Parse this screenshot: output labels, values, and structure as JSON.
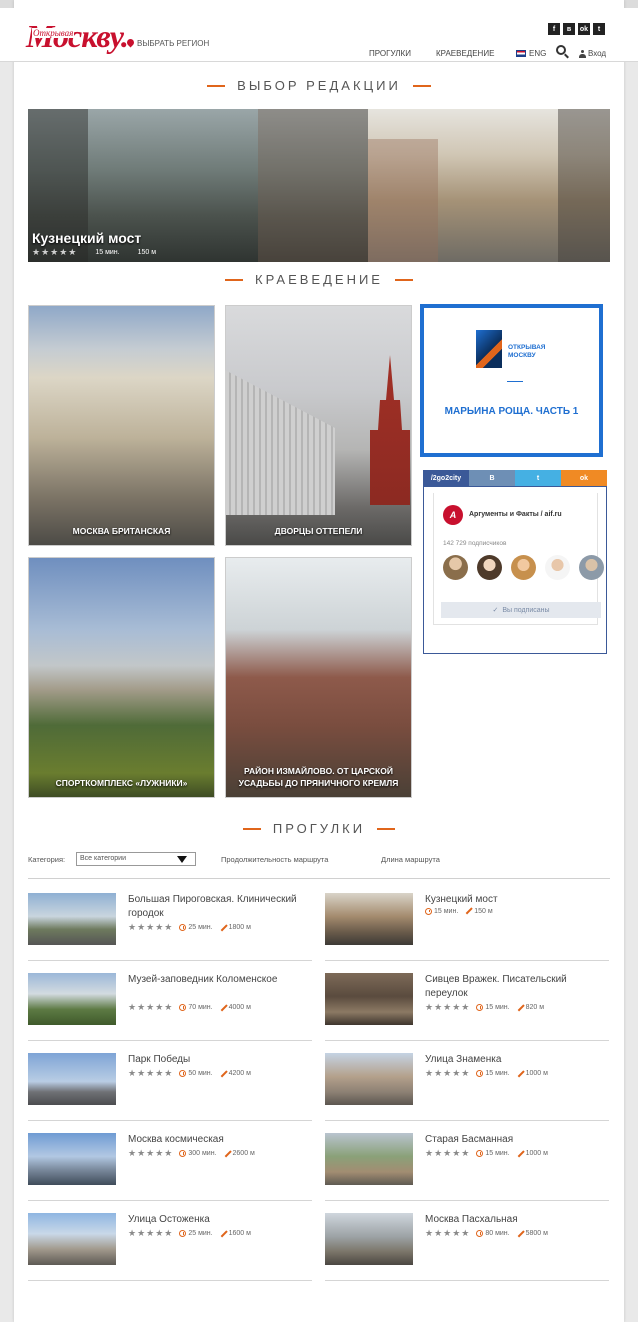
{
  "header": {
    "logo_small": "Открывая",
    "logo_big": "Москву.",
    "region": "ВЫБРАТЬ РЕГИОН",
    "social": [
      "f",
      "в",
      "ok",
      "t"
    ],
    "nav": {
      "walks": "ПРОГУЛКИ",
      "kraev": "КРАЕВЕДЕНИЕ",
      "lang": "ENG",
      "login": "Вход"
    }
  },
  "editors": {
    "title": "ВЫБОР РЕДАКЦИИ",
    "hero": {
      "name": "Кузнецкий мост",
      "stars": "★★★★★",
      "time": "15 мин.",
      "distance": "150 м"
    }
  },
  "kraev": {
    "title": "КРАЕВЕДЕНИЕ",
    "tiles": [
      {
        "label": "МОСКВА БРИТАНСКАЯ"
      },
      {
        "label": "ДВОРЦЫ ОТТЕПЕЛИ"
      },
      {
        "label": "СПОРТКОМПЛЕКС «ЛУЖНИКИ»"
      },
      {
        "label": "РАЙОН ИЗМАЙЛОВО. ОТ ЦАРСКОЙ УСАДЬБЫ ДО ПРЯНИЧНОГО КРЕМЛЯ"
      }
    ]
  },
  "ad": {
    "brand_line1": "ОТКРЫВАЯ",
    "brand_line2": "МОСКВУ",
    "text": "МАРЬИНА РОЩА. ЧАСТЬ 1"
  },
  "social_widget": {
    "tabs": {
      "fb": "/2go2city",
      "vk": "В",
      "tw": "t",
      "ok": "ok"
    },
    "logo": "A",
    "group_name": "Аргументы и Факты / aif.ru",
    "subscribers": "142 729 подписчиков",
    "subscribed": "Вы подписаны",
    "avatar_colors": [
      "#8a6e4b",
      "#b48a62",
      "#c7904d",
      "#3d3a36",
      "#8c9aa8"
    ]
  },
  "walks": {
    "title": "ПРОГУЛКИ",
    "filters": {
      "category_label": "Категория:",
      "category_value": "Все категории",
      "duration": "Продолжительность маршрута",
      "length": "Длина маршрута"
    },
    "items": [
      {
        "title": "Большая Пироговская. Клинический городок",
        "stars": "★★★★★",
        "time": "25 мин.",
        "distance": "1800 м"
      },
      {
        "title": "Кузнецкий мост",
        "stars": "",
        "time": "15 мин.",
        "distance": "150 м"
      },
      {
        "title": "Музей-заповедник Коломенское",
        "stars": "★★★★★",
        "time": "70 мин.",
        "distance": "4000 м"
      },
      {
        "title": "Сивцев Вражек. Писательский переулок",
        "stars": "★★★★★",
        "time": "15 мин.",
        "distance": "820 м"
      },
      {
        "title": "Парк Победы",
        "stars": "★★★★★",
        "time": "50 мин.",
        "distance": "4200 м"
      },
      {
        "title": "Улица Знаменка",
        "stars": "★★★★★",
        "time": "15 мин.",
        "distance": "1000 м"
      },
      {
        "title": "Москва космическая",
        "stars": "★★★★★",
        "time": "300 мин.",
        "distance": "2600 м"
      },
      {
        "title": "Старая Басманная",
        "stars": "★★★★★",
        "time": "15 мин.",
        "distance": "1000 м"
      },
      {
        "title": "Улица Остоженка",
        "stars": "★★★★★",
        "time": "25 мин.",
        "distance": "1600 м"
      },
      {
        "title": "Москва Пасхальная",
        "stars": "★★★★★",
        "time": "80 мин.",
        "distance": "5800 м"
      }
    ]
  }
}
